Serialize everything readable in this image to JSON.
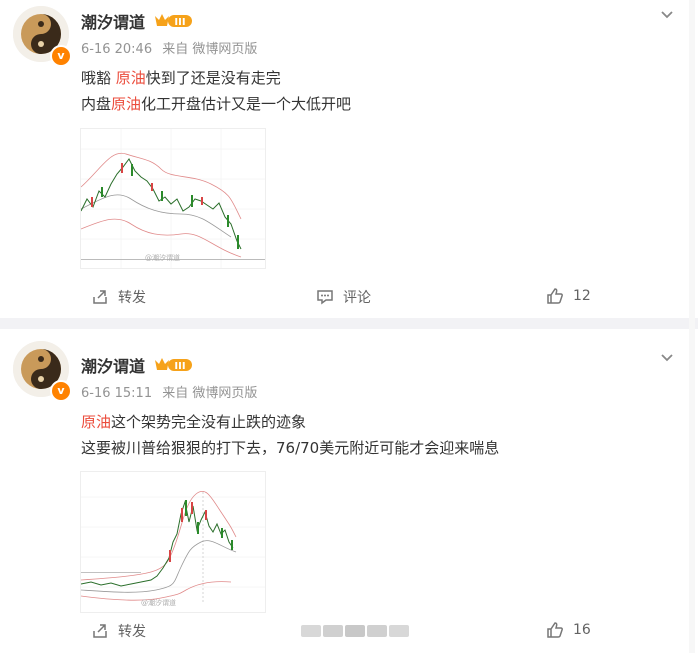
{
  "posts": [
    {
      "user": {
        "name": "潮汐谓道",
        "badge_level": "III",
        "verified_mark": "v"
      },
      "time": "6-16 20:46",
      "source": "来自 微博网页版",
      "lines": [
        {
          "a": "哦豁 ",
          "kw": "原油",
          "b": "快到了还是没有走完"
        },
        {
          "a": "内盘",
          "kw": "原油",
          "b": "化工开盘估计又是一个大低开吧"
        }
      ],
      "repost_label": "转发",
      "comment_label": "评论",
      "like_count": "12",
      "image_watermark": "@潮汐谓道"
    },
    {
      "user": {
        "name": "潮汐谓道",
        "badge_level": "III",
        "verified_mark": "v"
      },
      "time": "6-16 15:11",
      "source": "来自 微博网页版",
      "lines": [
        {
          "a": "",
          "kw": "原油",
          "b": "这个架势完全没有止跌的迹象"
        },
        {
          "a": "这要被川普给狠狠的打下去，76/70美元附近可能才会迎来喘息",
          "kw": "",
          "b": ""
        }
      ],
      "repost_label": "转发",
      "like_count": "16",
      "image_watermark": "@潮汐谓道"
    }
  ],
  "colors": {
    "keyword": "#eb4d3d",
    "accent": "#ff8200",
    "muted": "#939393"
  }
}
